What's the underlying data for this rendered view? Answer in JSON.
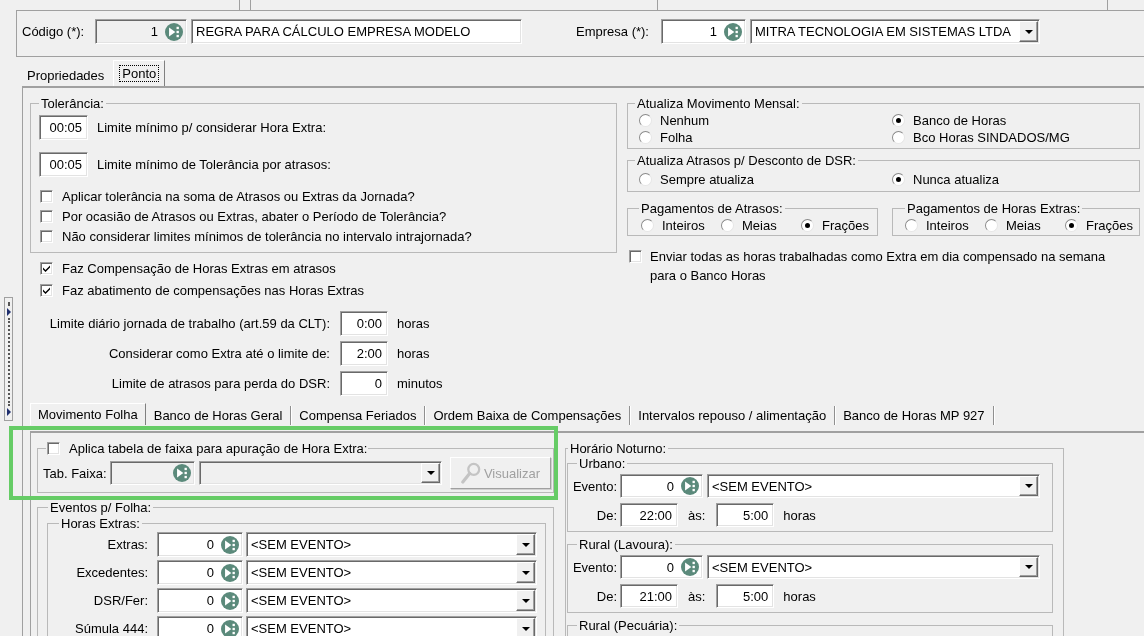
{
  "header": {
    "code_label": "Código (*):",
    "code": "1",
    "code_readonly": true,
    "name": "REGRA PARA CÁLCULO EMPRESA MODELO",
    "company_label": "Empresa (*):",
    "company_code": "1",
    "company_name": "MITRA TECNOLOGIA EM SISTEMAS LTDA"
  },
  "tabs": [
    {
      "label": "Propriedades",
      "selected": false
    },
    {
      "label": "Ponto",
      "selected": true
    }
  ],
  "tolerancia": {
    "title": "Tolerância:",
    "limits": [
      {
        "value": "00:05",
        "label": "Limite mínimo p/ considerar Hora Extra:"
      },
      {
        "value": "00:05",
        "label": "Limite mínimo de Tolerância por atrasos:"
      }
    ],
    "options": [
      {
        "label": "Aplicar tolerância na soma de Atrasos ou Extras da Jornada?",
        "checked": false
      },
      {
        "label": "Por ocasião de Atrasos ou Extras, abater o Período de Tolerância?",
        "checked": false
      },
      {
        "label": "Não considerar limites mínimos de tolerância no intervalo intrajornada?",
        "checked": false
      }
    ]
  },
  "compensacao": [
    {
      "label": "Faz Compensação de Horas Extras em atrasos",
      "checked": true
    },
    {
      "label": "Faz abatimento de compensações nas Horas Extras",
      "checked": true
    }
  ],
  "limites": [
    {
      "label": "Limite diário jornada de trabalho (art.59 da CLT):",
      "value": "0:00",
      "unit": "horas"
    },
    {
      "label": "Considerar como Extra até o limite de:",
      "value": "2:00",
      "unit": "horas"
    },
    {
      "label": "Limite de atrasos para perda do DSR:",
      "value": "0",
      "unit": "minutos"
    }
  ],
  "atualiza_movimento": {
    "title": "Atualiza Movimento Mensal:",
    "options": [
      {
        "label": "Nenhum",
        "selected": false
      },
      {
        "label": "Banco de Horas",
        "selected": true
      },
      {
        "label": "Folha",
        "selected": false
      },
      {
        "label": "Bco Horas SINDADOS/MG",
        "selected": false
      }
    ]
  },
  "atualiza_atrasos": {
    "title": "Atualiza Atrasos p/ Desconto de DSR:",
    "options": [
      {
        "label": "Sempre atualiza",
        "selected": false
      },
      {
        "label": "Nunca atualiza",
        "selected": true
      }
    ]
  },
  "pagamentos": [
    {
      "title": "Pagamentos de Atrasos:",
      "options": [
        {
          "label": "Inteiros",
          "selected": false
        },
        {
          "label": "Meias",
          "selected": false
        },
        {
          "label": "Frações",
          "selected": true
        }
      ]
    },
    {
      "title": "Pagamentos de Horas Extras:",
      "options": [
        {
          "label": "Inteiros",
          "selected": false
        },
        {
          "label": "Meias",
          "selected": false
        },
        {
          "label": "Frações",
          "selected": true
        }
      ]
    }
  ],
  "enviar_extras": {
    "label": "Enviar todas as horas trabalhadas como Extra em dia compensado na semana para o Banco Horas",
    "checked": false
  },
  "sub_tabs": [
    {
      "label": "Movimento Folha",
      "selected": true
    },
    {
      "label": "Banco de Horas Geral",
      "selected": false
    },
    {
      "label": "Compensa Feriados",
      "selected": false
    },
    {
      "label": "Ordem Baixa de Compensações",
      "selected": false
    },
    {
      "label": "Intervalos repouso / alimentação",
      "selected": false
    },
    {
      "label": "Banco de Horas MP 927",
      "selected": false
    }
  ],
  "faixa": {
    "highlighted": true,
    "label": "Aplica tabela de faixa para apuração de Hora Extra:",
    "checked": false,
    "field_label": "Tab. Faixa:",
    "disabled": true,
    "button": "Visualizar"
  },
  "eventos_folha": {
    "title": "Eventos p/ Folha:",
    "horas_extras": {
      "title": "Horas Extras:",
      "rows": [
        {
          "label": "Extras:",
          "code": "0",
          "event": "<SEM EVENTO>"
        },
        {
          "label": "Excedentes:",
          "code": "0",
          "event": "<SEM EVENTO>"
        },
        {
          "label": "DSR/Fer:",
          "code": "0",
          "event": "<SEM EVENTO>"
        },
        {
          "label": "Súmula 444:",
          "code": "0",
          "event": "<SEM EVENTO>"
        }
      ]
    }
  },
  "horario_noturno": {
    "title": "Horário Noturno:",
    "groups": [
      {
        "title": "Urbano:",
        "event_label": "Evento:",
        "code": "0",
        "event": "<SEM EVENTO>",
        "from_label": "De:",
        "from": "22:00",
        "to_label": "às:",
        "to": "5:00",
        "unit": "horas"
      },
      {
        "title": "Rural (Lavoura):",
        "event_label": "Evento:",
        "code": "0",
        "event": "<SEM EVENTO>",
        "from_label": "De:",
        "from": "21:00",
        "to_label": "às:",
        "to": "5:00",
        "unit": "horas"
      },
      {
        "title": "Rural (Pecuária):"
      }
    ]
  }
}
